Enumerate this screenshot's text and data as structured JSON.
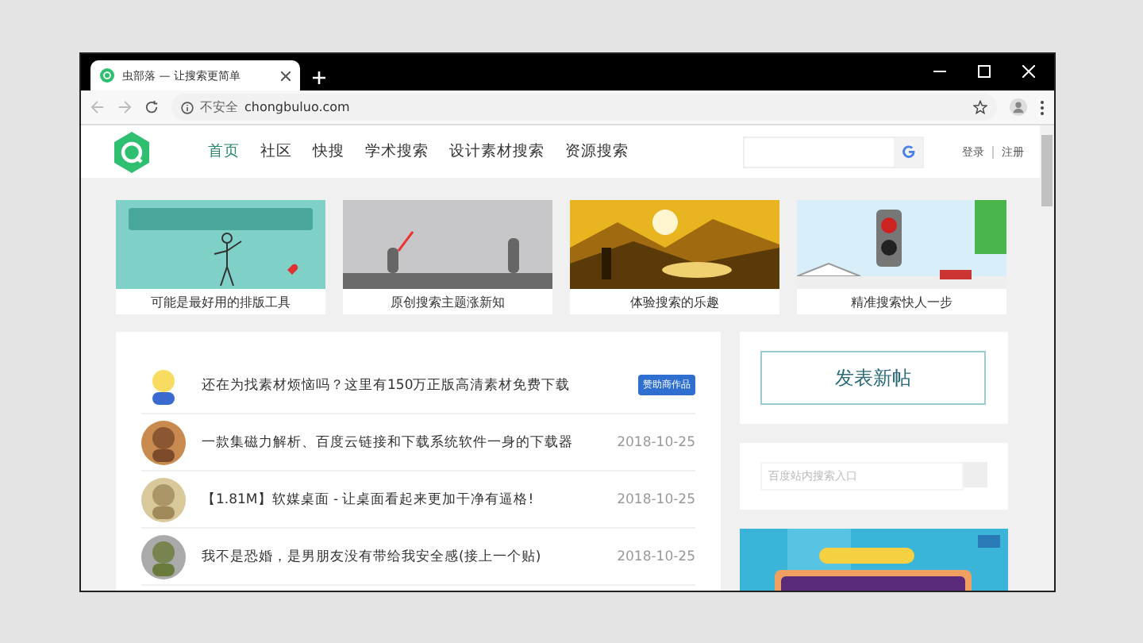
{
  "window": {
    "tab_title": "虫部落 — 让搜索更简单",
    "security": "不安全",
    "url": "chongbuluo.com"
  },
  "nav": [
    {
      "label": "首页",
      "selected": true
    },
    {
      "label": "社区",
      "selected": false
    },
    {
      "label": "快搜",
      "selected": false
    },
    {
      "label": "学术搜索",
      "selected": false
    },
    {
      "label": "设计素材搜索",
      "selected": false
    },
    {
      "label": "资源搜索",
      "selected": false
    }
  ],
  "auth": [
    "登录",
    "注册"
  ],
  "cards": [
    {
      "caption": "可能是最好用的排版工具"
    },
    {
      "caption": "原创搜索主题涨新知"
    },
    {
      "caption": "体验搜索的乐趣"
    },
    {
      "caption": "精准搜索快人一步"
    }
  ],
  "posts": [
    {
      "title": "还在为找素材烦恼吗？这里有150万正版高清素材免费下载",
      "kind": "sponsored",
      "tag": "赞助商作品"
    },
    {
      "title": "一款集磁力解析、百度云链接和下载系统软件一身的下载器",
      "kind": "dated",
      "date": "2018-10-25"
    },
    {
      "title": "【1.81M】软媒桌面 - 让桌面看起来更加干净有逼格!",
      "kind": "dated",
      "date": "2018-10-25"
    },
    {
      "title": "我不是恐婚，是男朋友没有带给我安全感(接上一个贴)",
      "kind": "dated",
      "date": "2018-10-25"
    }
  ],
  "sidebar": {
    "button": "发表新帖",
    "search_placeholder": "百度站内搜索入口"
  }
}
